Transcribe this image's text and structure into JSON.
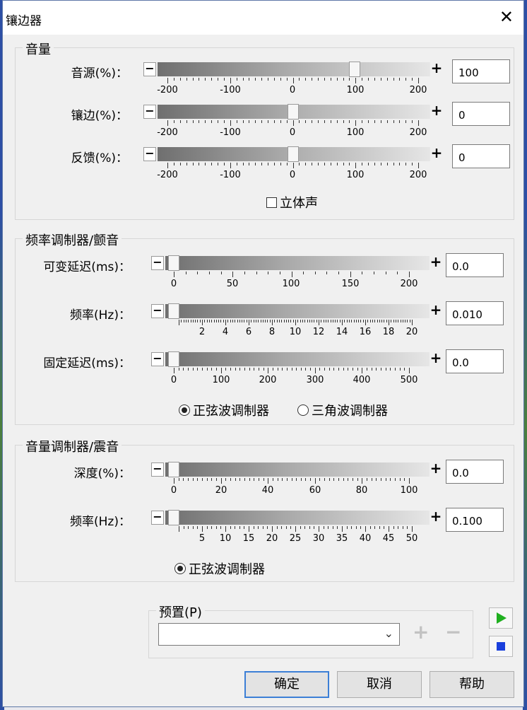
{
  "window": {
    "title": "镶边器",
    "close_glyph": "✕"
  },
  "volume": {
    "group_label": "音量",
    "rows": [
      {
        "label": "音源(%)：",
        "value": "100",
        "position": 100
      },
      {
        "label": "镶边(%)：",
        "value": "0",
        "position": 0
      },
      {
        "label": "反馈(%)：",
        "value": "0",
        "position": 0
      }
    ],
    "scale": [
      "-200",
      "-100",
      "0",
      "100",
      "200"
    ],
    "stereo_label": "立体声",
    "stereo_checked": false
  },
  "freq_mod": {
    "group_label": "频率调制器/颤音",
    "rows": [
      {
        "label": "可变延迟(ms)：",
        "value": "0.0",
        "scale": [
          "0",
          "50",
          "100",
          "150",
          "200"
        ]
      },
      {
        "label": "频率(Hz)：",
        "value": "0.010",
        "scale": [
          "2",
          "4",
          "6",
          "8",
          "10",
          "12",
          "14",
          "16",
          "18",
          "20"
        ]
      },
      {
        "label": "固定延迟(ms)：",
        "value": "0.0",
        "scale": [
          "0",
          "100",
          "200",
          "300",
          "400",
          "500"
        ]
      }
    ],
    "sine_label": "正弦波调制器",
    "triangle_label": "三角波调制器",
    "selected": "sine"
  },
  "amp_mod": {
    "group_label": "音量调制器/震音",
    "rows": [
      {
        "label": "深度(%)：",
        "value": "0.0",
        "scale": [
          "0",
          "20",
          "40",
          "60",
          "80",
          "100"
        ]
      },
      {
        "label": "频率(Hz)：",
        "value": "0.100",
        "scale": [
          "5",
          "10",
          "15",
          "20",
          "25",
          "30",
          "35",
          "40",
          "45",
          "50"
        ]
      }
    ],
    "sine_label": "正弦波调制器"
  },
  "presets": {
    "label": "预置(P)",
    "value": "",
    "add_glyph": "+",
    "remove_glyph": "−"
  },
  "buttons": {
    "ok": "确定",
    "cancel": "取消",
    "help": "帮助"
  },
  "colors": {
    "play": "#20b020",
    "stop": "#1a3fdc",
    "default_border": "#3c7fd6"
  }
}
